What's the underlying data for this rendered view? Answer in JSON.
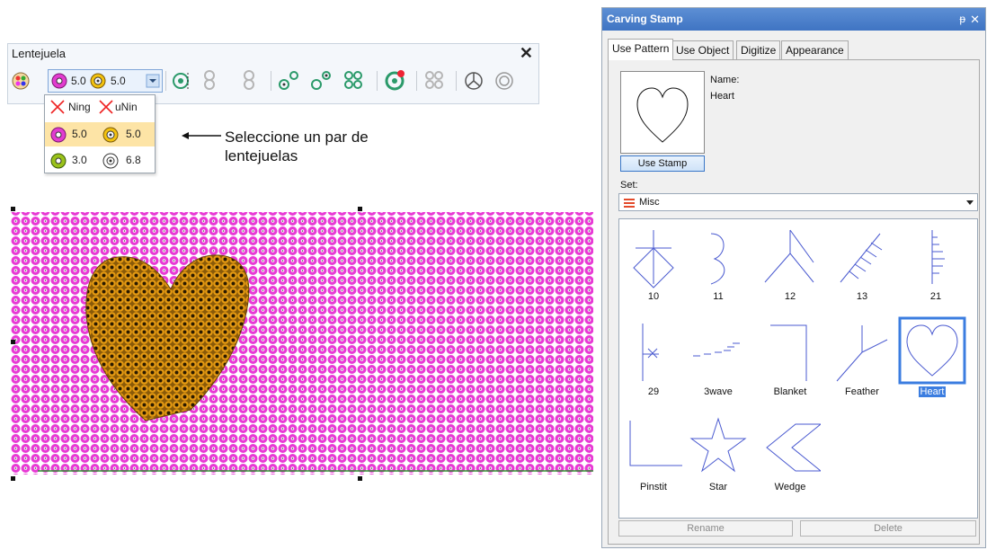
{
  "toolbar": {
    "title": "Lentejuela",
    "close_glyph": "✕",
    "pair": {
      "left": "5.0",
      "right": "5.0"
    },
    "icons": [
      "sequin-palette-icon",
      "sequin-single-icon",
      "sequin-run-icon",
      "sequin-pair-icon",
      "sequin-double-icon",
      "sequin-curve-icon",
      "sequin-step-icon",
      "sequin-drop-icon",
      "sequin-square-icon",
      "sequin-tack-icon",
      "sequin-settings-icon"
    ]
  },
  "dropdown": {
    "rows": [
      {
        "left": "Ning",
        "right": "uNin",
        "kind": "none"
      },
      {
        "left": "5.0",
        "right": "5.0",
        "kind": "pink"
      },
      {
        "left": "3.0",
        "right": "6.8",
        "kind": "green"
      }
    ]
  },
  "annotation": {
    "text": "Seleccione un par de lentejuelas"
  },
  "canvas": {
    "colors": {
      "bg": "#e839d5",
      "heart": "#e59a12",
      "stitch": "#2f8f2f"
    }
  },
  "panel": {
    "title": "Carving Stamp",
    "pin_glyph": "ᵽ",
    "close_glyph": "✕",
    "tabs": [
      "Use Pattern",
      "Use Object",
      "Digitize",
      "Appearance"
    ],
    "name_label": "Name:",
    "name_value": "Heart",
    "use_stamp_button": "Use Stamp",
    "set_label": "Set:",
    "set_value": "Misc",
    "stamps": [
      "10",
      "11",
      "12",
      "13",
      "21",
      "29",
      "3wave",
      "Blanket",
      "Feather",
      "Heart",
      "Pinstit",
      "Star",
      "Wedge"
    ],
    "selected_stamp": "Heart",
    "rename_button": "Rename",
    "delete_button": "Delete"
  }
}
